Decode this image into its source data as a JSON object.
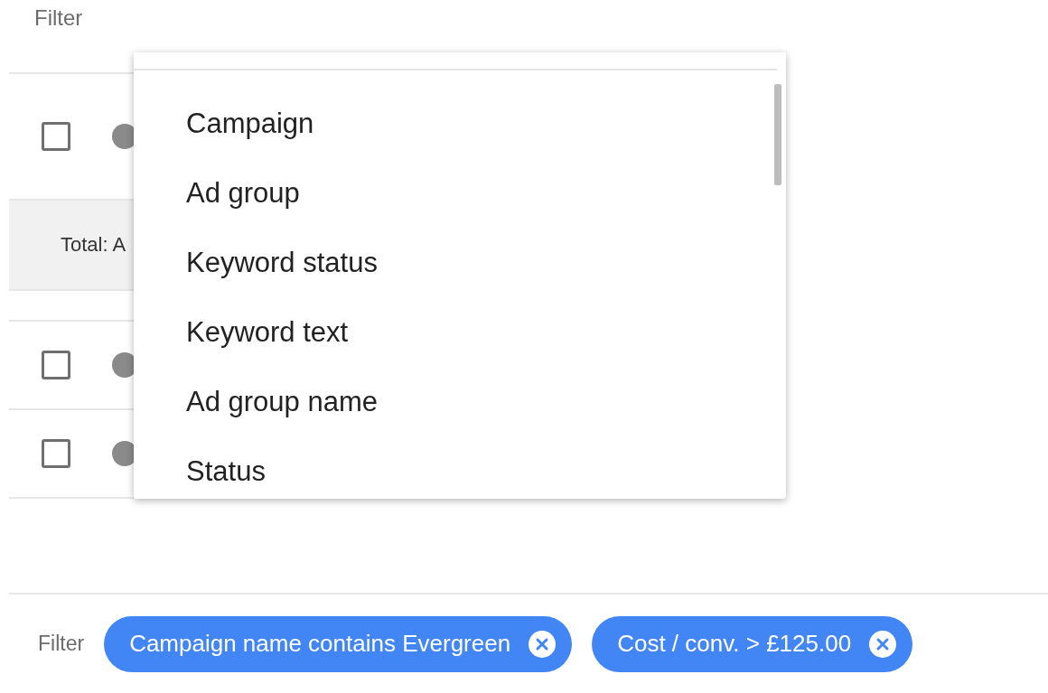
{
  "header": {
    "label": "Filter"
  },
  "table": {
    "rows": [
      {
        "kind": "item",
        "checked": false
      },
      {
        "kind": "total",
        "text": "Total: A"
      },
      {
        "kind": "item",
        "checked": false
      },
      {
        "kind": "item",
        "checked": false
      }
    ]
  },
  "menu": {
    "items": [
      "Campaign",
      "Ad group",
      "Keyword status",
      "Keyword text",
      "Ad group name",
      "Status"
    ]
  },
  "filter_bar": {
    "label": "Filter",
    "chips": [
      {
        "text": "Campaign name contains Evergreen"
      },
      {
        "text": "Cost / conv. > £125.00"
      }
    ]
  }
}
